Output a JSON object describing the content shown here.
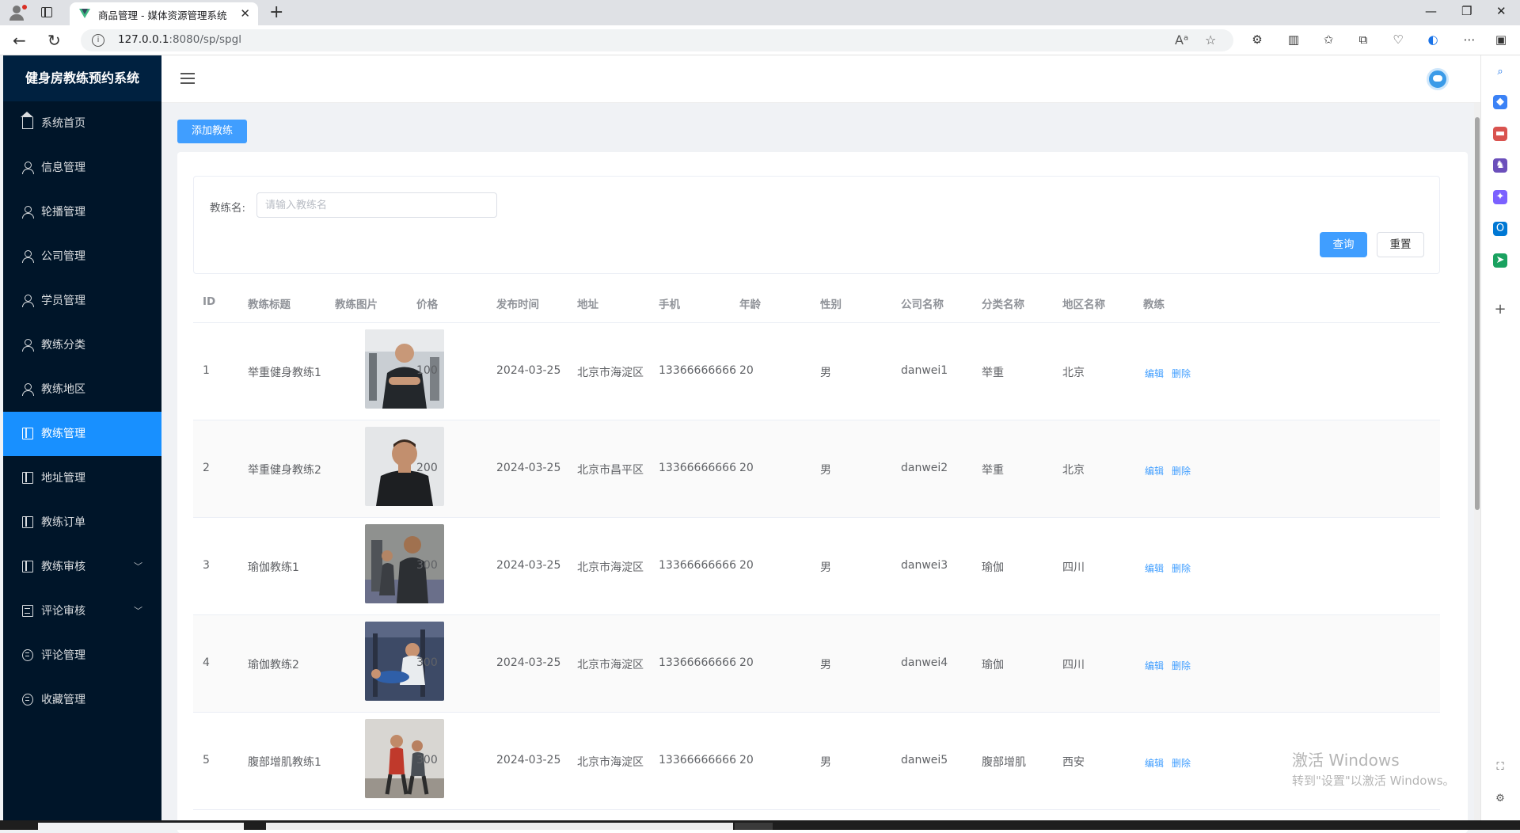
{
  "browser": {
    "tab_title": "商品管理 - 媒体资源管理系统",
    "url_host": "127.0.0.1",
    "url_rest": ":8080/sp/spgl"
  },
  "sidebar": {
    "title": "健身房教练预约系统",
    "items": [
      {
        "label": "系统首页",
        "icon": "home-icon"
      },
      {
        "label": "信息管理",
        "icon": "user-icon"
      },
      {
        "label": "轮播管理",
        "icon": "user-icon"
      },
      {
        "label": "公司管理",
        "icon": "user-icon"
      },
      {
        "label": "学员管理",
        "icon": "user-icon"
      },
      {
        "label": "教练分类",
        "icon": "user-icon"
      },
      {
        "label": "教练地区",
        "icon": "user-icon"
      },
      {
        "label": "教练管理",
        "icon": "book-icon",
        "active": true
      },
      {
        "label": "地址管理",
        "icon": "book-icon"
      },
      {
        "label": "教练订单",
        "icon": "book-icon"
      },
      {
        "label": "教练审核",
        "icon": "book-icon",
        "submenu": true
      },
      {
        "label": "评论审核",
        "icon": "doc-icon",
        "submenu": true
      },
      {
        "label": "评论管理",
        "icon": "chat-icon"
      },
      {
        "label": "收藏管理",
        "icon": "chat-icon"
      }
    ]
  },
  "toolbar": {
    "add_label": "添加教练"
  },
  "search": {
    "label": "教练名:",
    "placeholder": "请输入教练名",
    "query_label": "查询",
    "reset_label": "重置"
  },
  "table": {
    "columns": [
      "ID",
      "教练标题",
      "教练图片",
      "价格",
      "发布时间",
      "地址",
      "手机",
      "年龄",
      "性别",
      "公司名称",
      "分类名称",
      "地区名称",
      "教练"
    ],
    "edit_label": "编辑",
    "delete_label": "删除",
    "rows": [
      {
        "id": "1",
        "title": "举重健身教练1",
        "price": "100",
        "date": "2024-03-25",
        "addr": "北京市海淀区",
        "phone": "13366666666",
        "age": "20",
        "sex": "男",
        "company": "danwei1",
        "category": "举重",
        "region": "北京"
      },
      {
        "id": "2",
        "title": "举重健身教练2",
        "price": "200",
        "date": "2024-03-25",
        "addr": "北京市昌平区",
        "phone": "13366666666",
        "age": "20",
        "sex": "男",
        "company": "danwei2",
        "category": "举重",
        "region": "北京"
      },
      {
        "id": "3",
        "title": "瑜伽教练1",
        "price": "300",
        "date": "2024-03-25",
        "addr": "北京市海淀区",
        "phone": "13366666666",
        "age": "20",
        "sex": "男",
        "company": "danwei3",
        "category": "瑜伽",
        "region": "四川"
      },
      {
        "id": "4",
        "title": "瑜伽教练2",
        "price": "300",
        "date": "2024-03-25",
        "addr": "北京市海淀区",
        "phone": "13366666666",
        "age": "20",
        "sex": "男",
        "company": "danwei4",
        "category": "瑜伽",
        "region": "四川"
      },
      {
        "id": "5",
        "title": "腹部增肌教练1",
        "price": "300",
        "date": "2024-03-25",
        "addr": "北京市海淀区",
        "phone": "13366666666",
        "age": "20",
        "sex": "男",
        "company": "danwei5",
        "category": "腹部增肌",
        "region": "西安"
      }
    ]
  },
  "watermark": {
    "line1": "激活 Windows",
    "line2": "转到\"设置\"以激活 Windows。"
  },
  "colors": {
    "sidebar_bg": "#001529",
    "active_item": "#1890ff",
    "primary": "#409eff"
  }
}
